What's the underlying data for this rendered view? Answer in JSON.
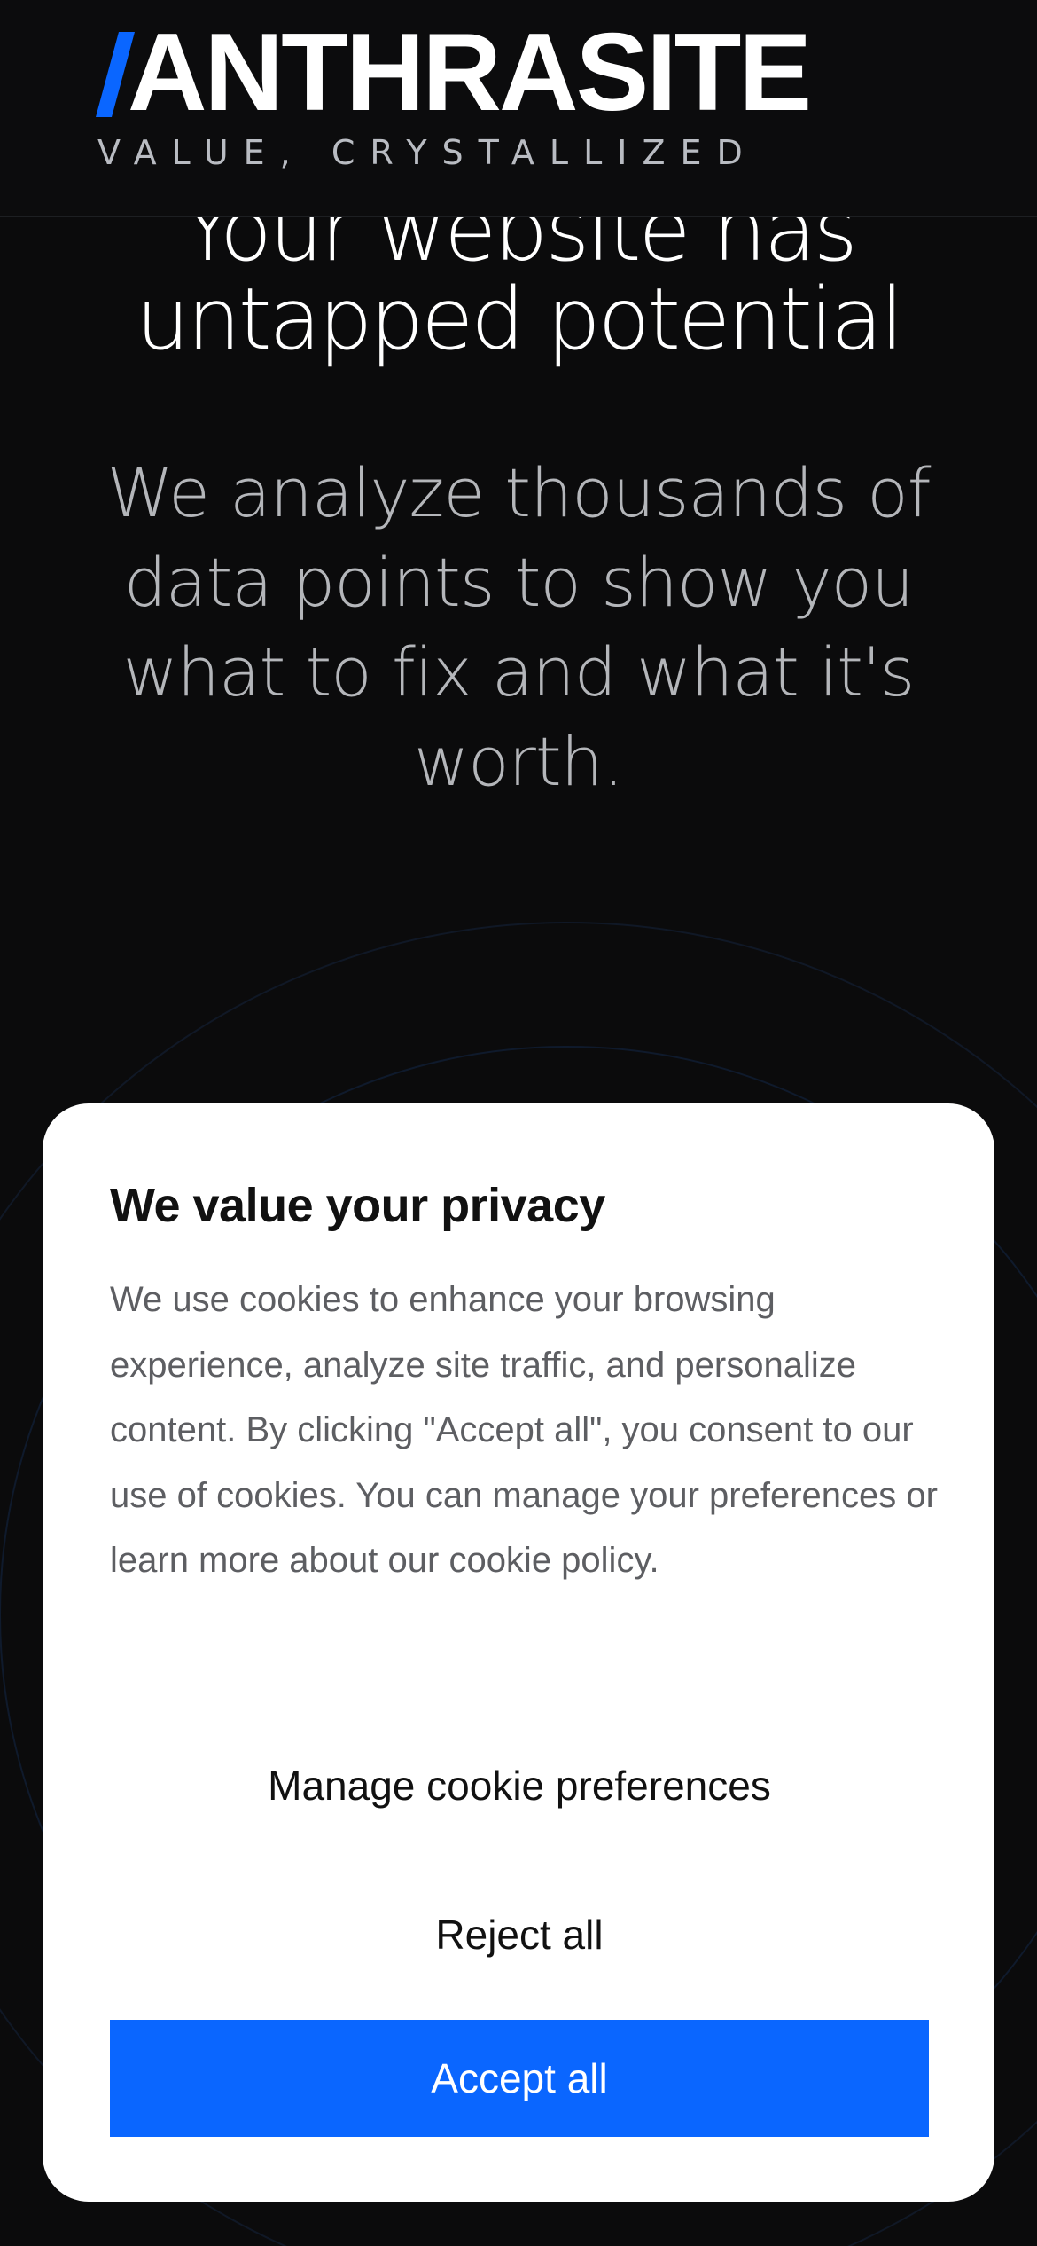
{
  "header": {
    "logo_text": "ANTHRASITE",
    "tagline": "VALUE, CRYSTALLIZED"
  },
  "hero": {
    "title_line1": "Your website has",
    "title_line2": "untapped potential",
    "subtitle": "We analyze thousands of data points to show you what to fix and what it's worth."
  },
  "cookie_banner": {
    "title": "We value your privacy",
    "body": "We use cookies to enhance your browsing experience, analyze site traffic, and personalize content. By clicking \"Accept all\", you consent to our use of cookies. You can manage your preferences or learn more about our cookie policy.",
    "manage_label": "Manage cookie preferences",
    "reject_label": "Reject all",
    "accept_label": "Accept all"
  },
  "colors": {
    "background": "#0b0b0c",
    "brand_blue": "#0a66ff",
    "dialog_bg": "#ffffff"
  },
  "icons": {
    "logo_mark": "logo-a-slash-icon"
  }
}
